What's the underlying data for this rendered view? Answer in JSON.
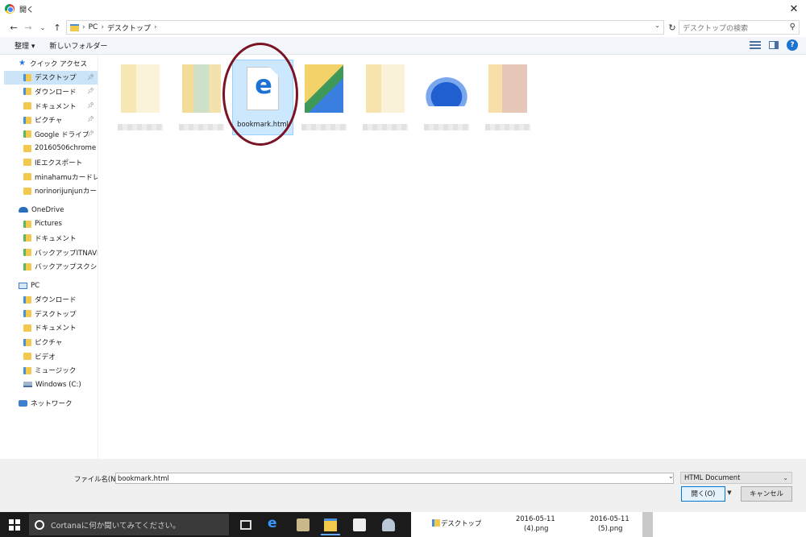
{
  "window": {
    "title": "開く",
    "close_glyph": "✕"
  },
  "nav": {
    "back": "←",
    "forward": "→",
    "recent": "⌄",
    "up": "↑"
  },
  "address": {
    "crumbs": [
      "PC",
      "デスクトップ"
    ],
    "separator": "›"
  },
  "search": {
    "placeholder": "デスクトップの検索"
  },
  "toolbar": {
    "organize": "整理 ▾",
    "new_folder": "新しいフォルダー"
  },
  "sidebar": {
    "quick_access": "クイック アクセス",
    "quick_items": [
      "デスクトップ",
      "ダウンロード",
      "ドキュメント",
      "ピクチャ",
      "Google ドライブ",
      "20160506chrome",
      "IEエクスポート",
      "minahamuカードレビュ",
      "norinorijunjunカードレ"
    ],
    "onedrive": "OneDrive",
    "onedrive_items": [
      "Pictures",
      "ドキュメント",
      "バックアップITNAVI",
      "バックアップスクショ"
    ],
    "pc": "PC",
    "pc_items": [
      "ダウンロード",
      "デスクトップ",
      "ドキュメント",
      "ピクチャ",
      "ビデオ",
      "ミュージック",
      "Windows (C:)"
    ],
    "network": "ネットワーク"
  },
  "files": {
    "selected_name": "bookmark.html"
  },
  "bottom": {
    "filename_label": "ファイル名(N):",
    "filename_value": "bookmark.html",
    "filetype": "HTML Document",
    "open_button": "開く(O)",
    "cancel_button": "キャンセル"
  },
  "taskbar": {
    "cortana_placeholder": "Cortanaに何か聞いてみてください。"
  },
  "background_window": {
    "folder": "デスクトップ",
    "file1_date": "2016-05-11",
    "file1_name": "(4).png",
    "file2_date": "2016-05-11",
    "file2_name": "(5).png"
  },
  "colors": {
    "annotation_ring": "#7a1323",
    "selection": "#cce8ff",
    "accent": "#0078d7"
  }
}
